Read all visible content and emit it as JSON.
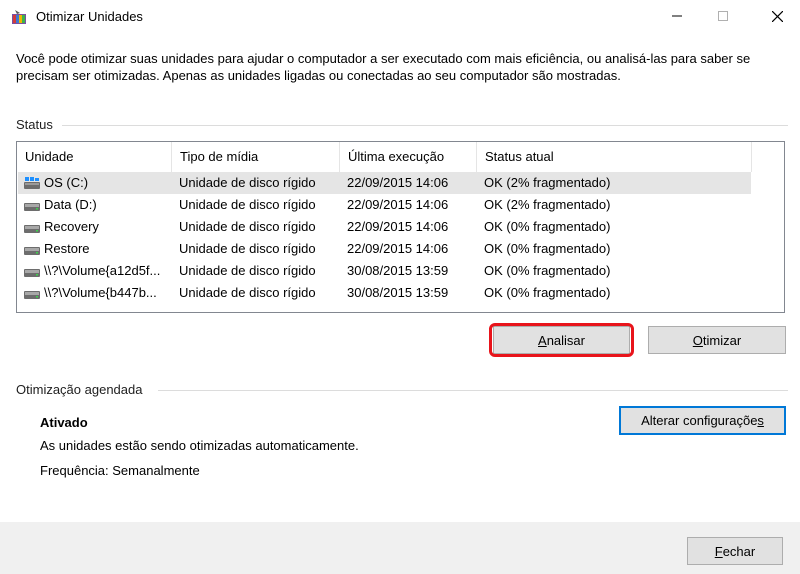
{
  "window": {
    "title": "Otimizar Unidades",
    "icon": "defrag-app-icon",
    "controls": [
      "minimize",
      "maximize",
      "close"
    ]
  },
  "description": "Você pode otimizar suas unidades para ajudar o computador a ser executado com mais eficiência, ou analisá-las para saber se precisam ser otimizadas. Apenas as unidades ligadas ou conectadas ao seu computador são mostradas.",
  "status_section": {
    "label": "Status",
    "columns": [
      "Unidade",
      "Tipo de mídia",
      "Última execução",
      "Status atual"
    ],
    "rows": [
      {
        "unidade": "OS (C:)",
        "tipo": "Unidade de disco rígido",
        "execucao": "22/09/2015 14:06",
        "status": "OK (2% fragmentado)",
        "icon": "windows-drive-icon",
        "selected": true
      },
      {
        "unidade": "Data (D:)",
        "tipo": "Unidade de disco rígido",
        "execucao": "22/09/2015 14:06",
        "status": "OK (2% fragmentado)",
        "icon": "drive-icon"
      },
      {
        "unidade": "Recovery",
        "tipo": "Unidade de disco rígido",
        "execucao": "22/09/2015 14:06",
        "status": "OK (0% fragmentado)",
        "icon": "drive-icon"
      },
      {
        "unidade": "Restore",
        "tipo": "Unidade de disco rígido",
        "execucao": "22/09/2015 14:06",
        "status": "OK (0% fragmentado)",
        "icon": "drive-icon"
      },
      {
        "unidade": "\\\\?\\Volume{a12d5f...",
        "tipo": "Unidade de disco rígido",
        "execucao": "30/08/2015 13:59",
        "status": "OK (0% fragmentado)",
        "icon": "drive-icon"
      },
      {
        "unidade": "\\\\?\\Volume{b447b...",
        "tipo": "Unidade de disco rígido",
        "execucao": "30/08/2015 13:59",
        "status": "OK (0% fragmentado)",
        "icon": "drive-icon"
      }
    ],
    "buttons": {
      "analisar": {
        "accel": "A",
        "rest": "nalisar"
      },
      "otimizar": {
        "accel": "O",
        "rest": "timizar"
      }
    }
  },
  "schedule_section": {
    "label": "Otimização agendada",
    "state": "Ativado",
    "info": "As unidades estão sendo otimizadas automaticamente.",
    "frequency": "Frequência: Semanalmente",
    "change_button": {
      "before": "Alterar configuraçõe",
      "accel": "s",
      "after": ""
    }
  },
  "footer": {
    "close_button": {
      "accel": "F",
      "rest": "echar"
    }
  },
  "colors": {
    "highlight": "#e8141b",
    "selected_row": "#e5e5e5",
    "focus_border": "#0078d7"
  }
}
